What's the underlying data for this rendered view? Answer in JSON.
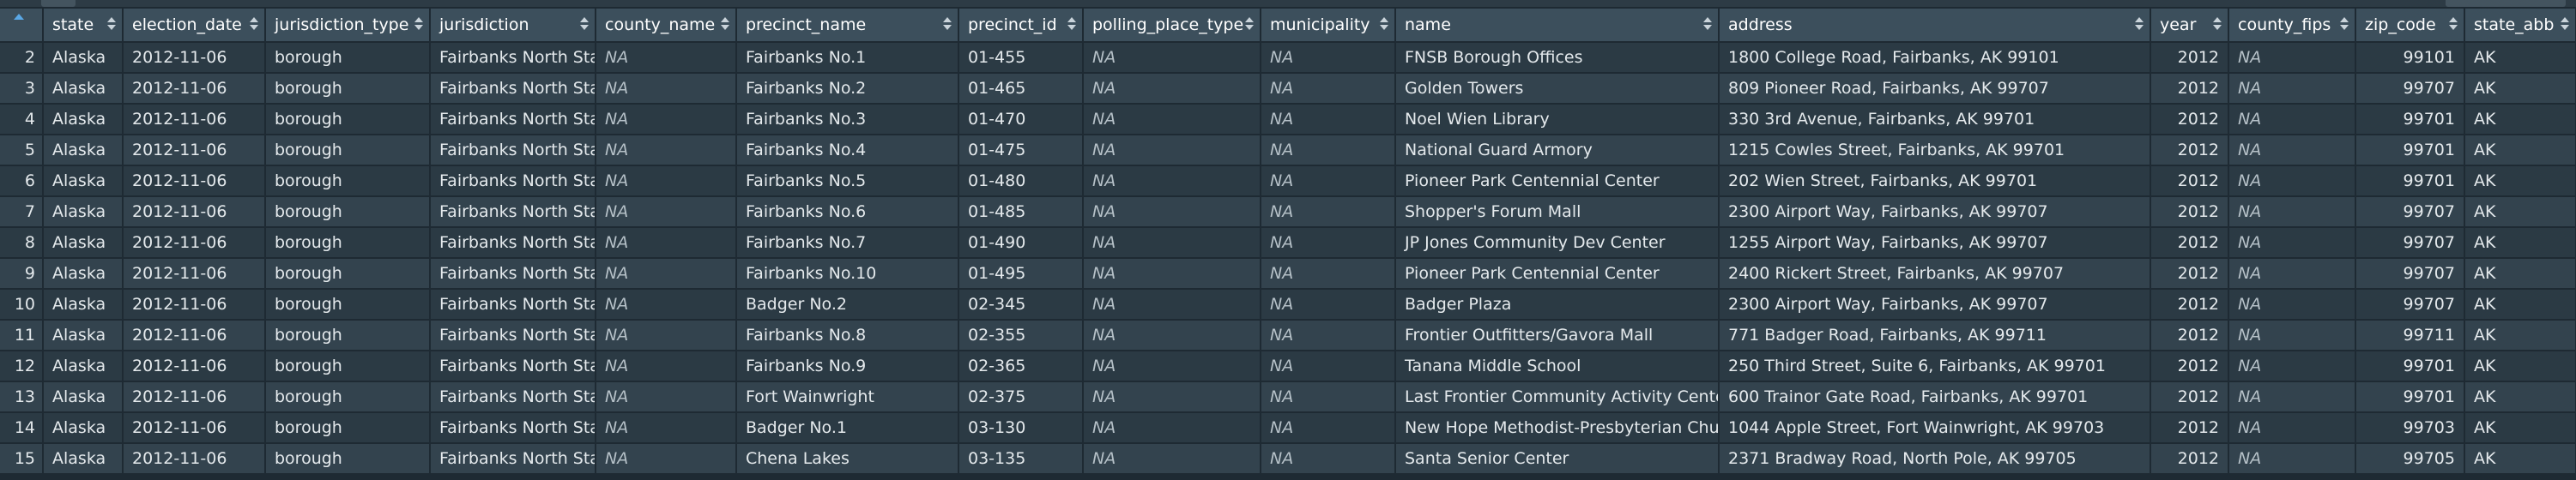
{
  "columns": [
    {
      "key": "state",
      "label": "state"
    },
    {
      "key": "election_date",
      "label": "election_date"
    },
    {
      "key": "jurisdiction_type",
      "label": "jurisdiction_type"
    },
    {
      "key": "jurisdiction",
      "label": "jurisdiction"
    },
    {
      "key": "county_name",
      "label": "county_name"
    },
    {
      "key": "precinct_name",
      "label": "precinct_name"
    },
    {
      "key": "precinct_id",
      "label": "precinct_id"
    },
    {
      "key": "polling_place_type",
      "label": "polling_place_type"
    },
    {
      "key": "municipality",
      "label": "municipality"
    },
    {
      "key": "name",
      "label": "name"
    },
    {
      "key": "address",
      "label": "address"
    },
    {
      "key": "year",
      "label": "year"
    },
    {
      "key": "county_fips",
      "label": "county_fips"
    },
    {
      "key": "zip_code",
      "label": "zip_code"
    },
    {
      "key": "state_abb",
      "label": "state_abb"
    }
  ],
  "rows": [
    {
      "n": "2",
      "cells": [
        "Alaska",
        "2012-11-06",
        "borough",
        "Fairbanks North Star",
        "NA",
        "Fairbanks No.1",
        "01-455",
        "NA",
        "NA",
        "FNSB Borough Offices",
        "1800 College Road, Fairbanks, AK 99101",
        "2012",
        "NA",
        "99101",
        "AK"
      ]
    },
    {
      "n": "3",
      "cells": [
        "Alaska",
        "2012-11-06",
        "borough",
        "Fairbanks North Star",
        "NA",
        "Fairbanks No.2",
        "01-465",
        "NA",
        "NA",
        "Golden Towers",
        "809 Pioneer Road, Fairbanks, AK 99707",
        "2012",
        "NA",
        "99707",
        "AK"
      ]
    },
    {
      "n": "4",
      "cells": [
        "Alaska",
        "2012-11-06",
        "borough",
        "Fairbanks North Star",
        "NA",
        "Fairbanks No.3",
        "01-470",
        "NA",
        "NA",
        "Noel Wien Library",
        "330 3rd Avenue, Fairbanks, AK 99701",
        "2012",
        "NA",
        "99701",
        "AK"
      ]
    },
    {
      "n": "5",
      "cells": [
        "Alaska",
        "2012-11-06",
        "borough",
        "Fairbanks North Star",
        "NA",
        "Fairbanks No.4",
        "01-475",
        "NA",
        "NA",
        "National Guard Armory",
        "1215 Cowles Street, Fairbanks, AK 99701",
        "2012",
        "NA",
        "99701",
        "AK"
      ]
    },
    {
      "n": "6",
      "cells": [
        "Alaska",
        "2012-11-06",
        "borough",
        "Fairbanks North Star",
        "NA",
        "Fairbanks No.5",
        "01-480",
        "NA",
        "NA",
        "Pioneer Park Centennial Center",
        "202 Wien Street, Fairbanks, AK 99701",
        "2012",
        "NA",
        "99701",
        "AK"
      ]
    },
    {
      "n": "7",
      "cells": [
        "Alaska",
        "2012-11-06",
        "borough",
        "Fairbanks North Star",
        "NA",
        "Fairbanks No.6",
        "01-485",
        "NA",
        "NA",
        "Shopper's Forum Mall",
        "2300 Airport Way, Fairbanks, AK 99707",
        "2012",
        "NA",
        "99707",
        "AK"
      ]
    },
    {
      "n": "8",
      "cells": [
        "Alaska",
        "2012-11-06",
        "borough",
        "Fairbanks North Star",
        "NA",
        "Fairbanks No.7",
        "01-490",
        "NA",
        "NA",
        "JP Jones Community Dev Center",
        "1255 Airport Way, Fairbanks, AK 99707",
        "2012",
        "NA",
        "99707",
        "AK"
      ]
    },
    {
      "n": "9",
      "cells": [
        "Alaska",
        "2012-11-06",
        "borough",
        "Fairbanks North Star",
        "NA",
        "Fairbanks No.10",
        "01-495",
        "NA",
        "NA",
        "Pioneer Park Centennial Center",
        "2400 Rickert Street, Fairbanks, AK 99707",
        "2012",
        "NA",
        "99707",
        "AK"
      ]
    },
    {
      "n": "10",
      "cells": [
        "Alaska",
        "2012-11-06",
        "borough",
        "Fairbanks North Star",
        "NA",
        "Badger No.2",
        "02-345",
        "NA",
        "NA",
        "Badger Plaza",
        "2300 Airport Way, Fairbanks, AK 99707",
        "2012",
        "NA",
        "99707",
        "AK"
      ]
    },
    {
      "n": "11",
      "cells": [
        "Alaska",
        "2012-11-06",
        "borough",
        "Fairbanks North Star",
        "NA",
        "Fairbanks No.8",
        "02-355",
        "NA",
        "NA",
        "Frontier Outfitters/Gavora Mall",
        "771 Badger Road, Fairbanks, AK 99711",
        "2012",
        "NA",
        "99711",
        "AK"
      ]
    },
    {
      "n": "12",
      "cells": [
        "Alaska",
        "2012-11-06",
        "borough",
        "Fairbanks North Star",
        "NA",
        "Fairbanks No.9",
        "02-365",
        "NA",
        "NA",
        "Tanana Middle School",
        "250 Third Street, Suite 6, Fairbanks, AK 99701",
        "2012",
        "NA",
        "99701",
        "AK"
      ]
    },
    {
      "n": "13",
      "cells": [
        "Alaska",
        "2012-11-06",
        "borough",
        "Fairbanks North Star",
        "NA",
        "Fort Wainwright",
        "02-375",
        "NA",
        "NA",
        "Last Frontier Community Activity Center",
        "600 Trainor Gate Road, Fairbanks, AK 99701",
        "2012",
        "NA",
        "99701",
        "AK"
      ]
    },
    {
      "n": "14",
      "cells": [
        "Alaska",
        "2012-11-06",
        "borough",
        "Fairbanks North Star",
        "NA",
        "Badger No.1",
        "03-130",
        "NA",
        "NA",
        "New Hope Methodist-Presbyterian Church",
        "1044 Apple Street, Fort Wainwright, AK 99703",
        "2012",
        "NA",
        "99703",
        "AK"
      ]
    },
    {
      "n": "15",
      "cells": [
        "Alaska",
        "2012-11-06",
        "borough",
        "Fairbanks North Star",
        "NA",
        "Chena Lakes",
        "03-135",
        "NA",
        "NA",
        "Santa Senior Center",
        "2371 Bradway Road, North Pole, AK 99705",
        "2012",
        "NA",
        "99705",
        "AK"
      ]
    }
  ]
}
